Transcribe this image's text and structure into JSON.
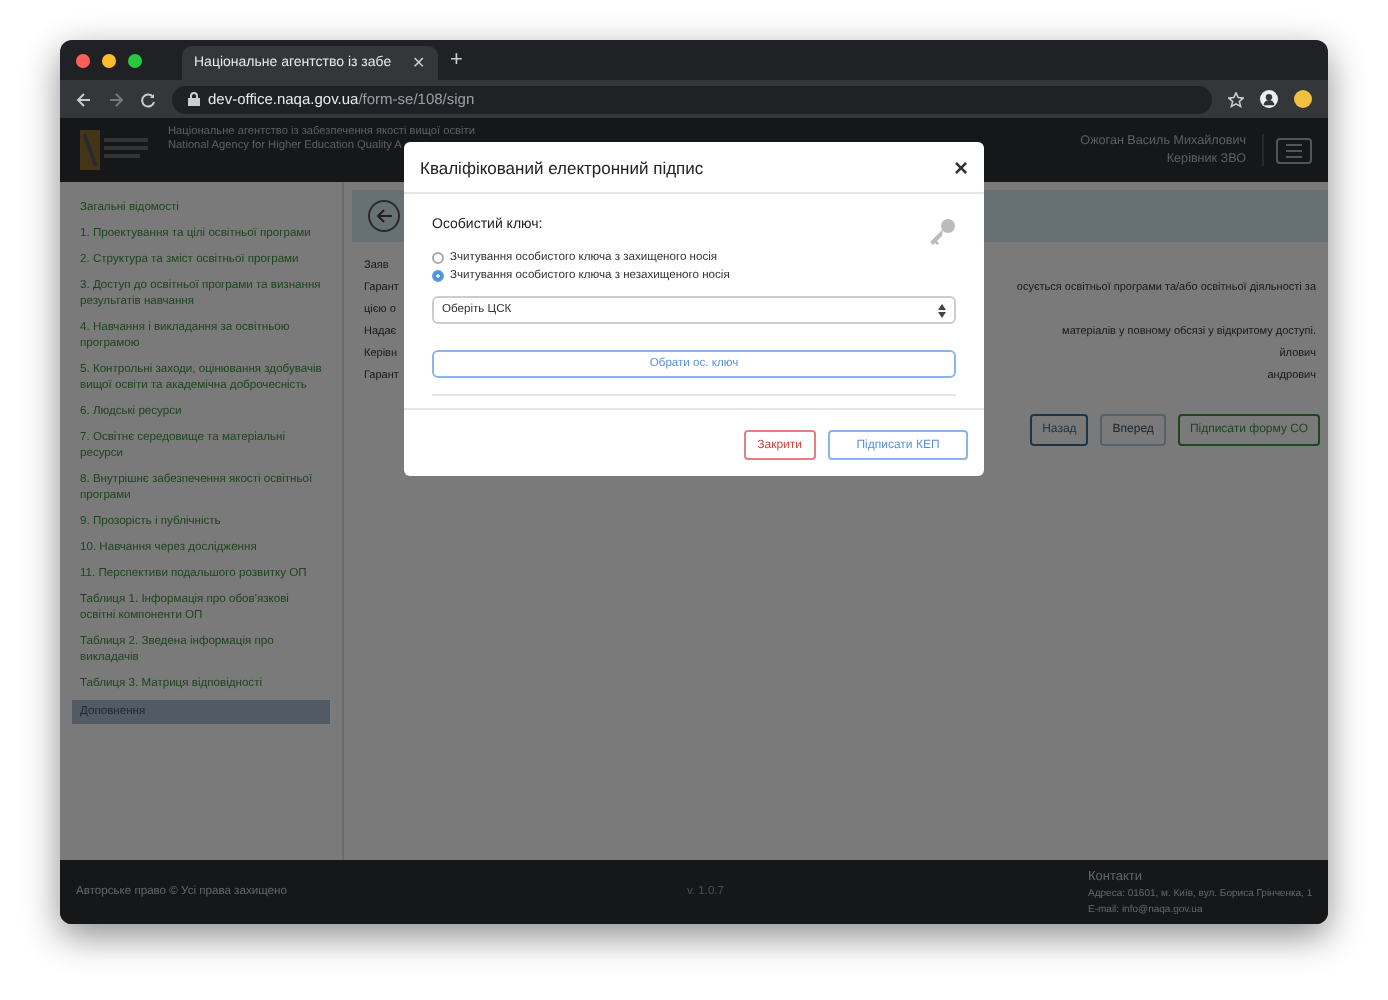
{
  "browser": {
    "tab_title": "Національне агентство із забе",
    "tab_close": "✕",
    "new_tab": "+",
    "url_host": "dev-office.naqa.gov.ua",
    "url_path": "/form-se/108/sign"
  },
  "header": {
    "title_ua": "Національне агентство із забезпечення якості вищої освіти",
    "title_en": "National Agency for Higher Education Quality A",
    "user_name": "Ожоган Василь Михайлович",
    "user_role": "Керівник ЗВО"
  },
  "sidebar": {
    "items": [
      {
        "label": "Загальні відомості",
        "selected": false
      },
      {
        "label": "1. Проектування та цілі освітньої програми",
        "selected": false
      },
      {
        "label": "2. Структура та зміст освітньої програми",
        "selected": false
      },
      {
        "label": "3. Доступ до освітньої програми та визнання результатів навчання",
        "selected": false
      },
      {
        "label": "4. Навчання і викладання за освітньою програмою",
        "selected": false
      },
      {
        "label": "5. Контрольні заходи, оцінювання здобувачів вищої освіти та академічна доброчесність",
        "selected": false
      },
      {
        "label": "6. Людські ресурси",
        "selected": false
      },
      {
        "label": "7. Освітнє середовище та матеріальні ресурси",
        "selected": false
      },
      {
        "label": "8. Внутрішнє забезпечення якості освітньої програми",
        "selected": false
      },
      {
        "label": "9. Прозорість і публічність",
        "selected": false
      },
      {
        "label": "10. Навчання через дослідження",
        "selected": false
      },
      {
        "label": "11. Перспективи подальшого розвитку ОП",
        "selected": false
      },
      {
        "label": "Таблиця 1. Інформація про обов'язкові освітні компоненти ОП",
        "selected": false
      },
      {
        "label": "Таблиця 2. Зведена інформація про викладачів",
        "selected": false
      },
      {
        "label": "Таблиця 3. Матриця відповідності",
        "selected": false
      },
      {
        "label": "Доповнення",
        "selected": true
      }
    ]
  },
  "content": {
    "rows": [
      {
        "left": "Заяв",
        "right": ""
      },
      {
        "left": "Гарант",
        "right": "осується освітньої програми та/або освітньої діяльності за"
      },
      {
        "left": "цією о",
        "right": ""
      },
      {
        "left": "Надає",
        "right": "матеріалів у повному обсязі у відкритому доступі."
      },
      {
        "left": "Керівн",
        "right": "йлович"
      },
      {
        "left": "Гарант",
        "right": "андрович"
      }
    ],
    "buttons": [
      {
        "label": "Назад",
        "kind": "secondary"
      },
      {
        "label": "Вперед",
        "kind": "disabled"
      },
      {
        "label": "Підписати форму СО",
        "kind": "success"
      }
    ]
  },
  "footer": {
    "copyright": "Авторське право © Усі права захищено",
    "version": "v. 1.0.7",
    "contacts_title": "Контакти",
    "address": "Адреса: 01601, м. Київ, вул. Бориса Грінченка, 1",
    "email": "E-mail: info@naqa.gov.ua"
  },
  "modal": {
    "title": "Кваліфікований електронний підпис",
    "close": "×",
    "key_label": "Особистий ключ:",
    "options": [
      {
        "label": "Зчитування особистого ключа з захищеного носія",
        "selected": false
      },
      {
        "label": "Зчитування особистого ключа з незахищеного носія",
        "selected": true
      }
    ],
    "select_value": "Оберіть ЦСК",
    "choose_key": "Обрати ос. ключ",
    "buttons": [
      {
        "label": "Закрити",
        "kind": "danger"
      },
      {
        "label": "Підписати КЕП",
        "kind": "primary"
      }
    ]
  }
}
